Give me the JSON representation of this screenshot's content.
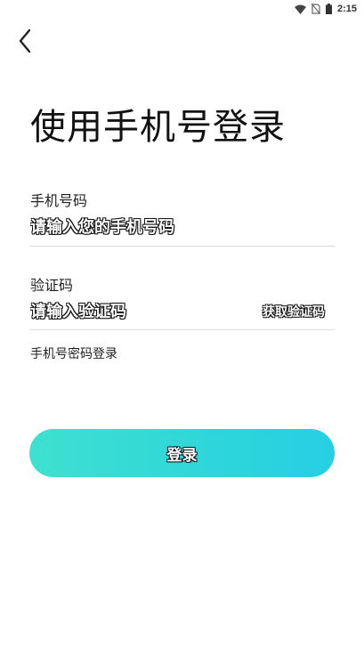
{
  "status_bar": {
    "time": "2:15",
    "icons": [
      "wifi-icon",
      "no-sim-icon",
      "battery-icon"
    ]
  },
  "header": {
    "back_icon": "chevron-left-icon",
    "title": "使用手机号登录"
  },
  "form": {
    "phone": {
      "label": "手机号码",
      "placeholder": "请输入您的手机号码",
      "value": ""
    },
    "code": {
      "label": "验证码",
      "placeholder": "请输入验证码",
      "value": "",
      "get_code_label": "获取验证码"
    },
    "password_login_link": "手机号密码登录",
    "submit_label": "登录"
  },
  "colors": {
    "button_gradient_start": "#3ee0cf",
    "button_gradient_end": "#26cfe3",
    "divider": "#dcdcdc"
  }
}
